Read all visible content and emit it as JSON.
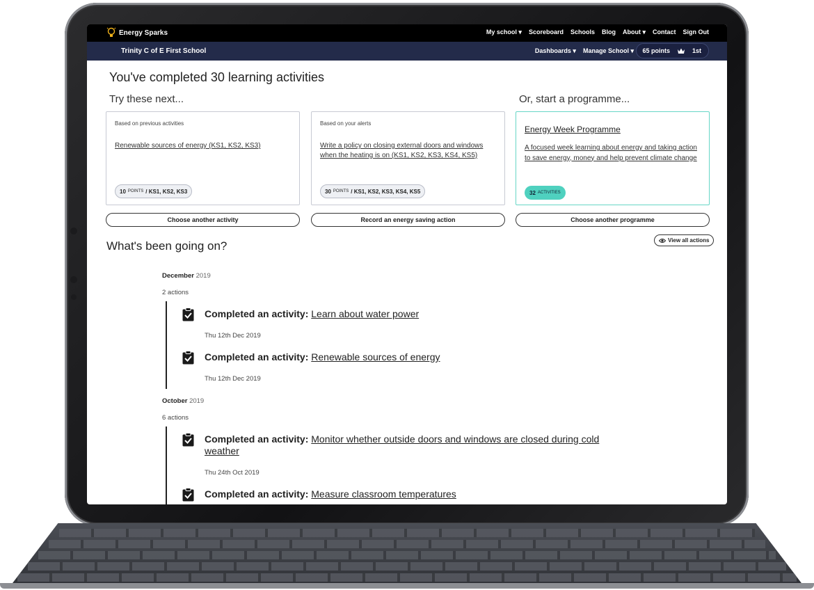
{
  "app": {
    "brand": "Energy Sparks"
  },
  "topnav": {
    "items": [
      "My school ▾",
      "Scoreboard",
      "Schools",
      "Blog",
      "About ▾",
      "Contact",
      "Sign Out"
    ]
  },
  "subbar": {
    "school": "Trinity C of E First School",
    "dashboards": "Dashboards ▾",
    "manage": "Manage School ▾",
    "points": "65 points",
    "rank": "1st"
  },
  "main": {
    "heading": "You've completed 30 learning activities",
    "try_next": "Try these next...",
    "programme_heading": "Or, start a programme...",
    "cards": [
      {
        "label": "Based on previous activities",
        "link": "Renewable sources of energy (KS1, KS2, KS3)",
        "points": "10",
        "points_word": "POINTS",
        "stages": "/ KS1, KS2, KS3"
      },
      {
        "label": "Based on your alerts",
        "link": "Write a policy on closing external doors and windows when the heating is on (KS1, KS2, KS3, KS4, KS5)",
        "points": "30",
        "points_word": "POINTS",
        "stages": "/ KS1, KS2, KS3, KS4, KS5"
      }
    ],
    "programme": {
      "title": "Energy Week Programme",
      "description": "A focused week learning about energy and taking action to save energy, money and help prevent climate change",
      "count": "32",
      "count_word": "ACTIVITIES"
    },
    "buttons": {
      "choose_activity": "Choose another activity",
      "record_action": "Record an energy saving action",
      "choose_programme": "Choose another programme"
    }
  },
  "timeline": {
    "heading": "What's been going on?",
    "view_all": "View all actions",
    "groups": [
      {
        "month": "December",
        "year": "2019",
        "count": "2 actions",
        "entries": [
          {
            "prefix": "Completed an activity:",
            "title": "Learn about water power",
            "date": "Thu 12th Dec 2019"
          },
          {
            "prefix": "Completed an activity:",
            "title": "Renewable sources of energy",
            "date": "Thu 12th Dec 2019"
          }
        ]
      },
      {
        "month": "October",
        "year": "2019",
        "count": "6 actions",
        "entries": [
          {
            "prefix": "Completed an activity:",
            "title": "Monitor whether outside doors and windows are closed during cold weather",
            "date": "Thu 24th Oct 2019"
          },
          {
            "prefix": "Completed an activity:",
            "title": "Measure classroom temperatures",
            "date": ""
          }
        ]
      }
    ]
  },
  "colors": {
    "topbar": "#000000",
    "subbar": "#232b4a",
    "programme_accent": "#4fd1bf"
  },
  "icons": [
    "lightbulb-icon",
    "crown-icon",
    "eye-icon",
    "clipboard-check-icon"
  ]
}
